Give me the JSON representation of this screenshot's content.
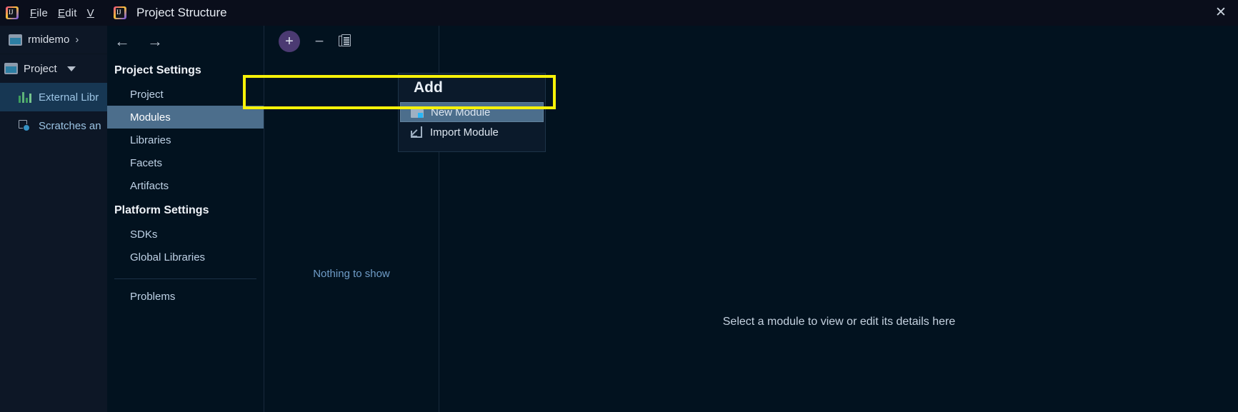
{
  "ide": {
    "logo_icon": "intellij-logo-icon",
    "menu": [
      {
        "label": "File",
        "mnemonic": "F",
        "rest": "ile"
      },
      {
        "label": "Edit",
        "mnemonic": "E",
        "rest": "dit"
      },
      {
        "label": "V",
        "mnemonic": "V",
        "rest": ""
      }
    ],
    "breadcrumb": {
      "project": "rmidemo",
      "chevron": "›",
      "icon": "module-icon"
    },
    "tool_window": {
      "title": "Project",
      "icon": "module-icon",
      "caret": "chevron-down-icon"
    },
    "tree": [
      {
        "label": "External Libr",
        "icon": "library-bars-icon",
        "selected": true
      },
      {
        "label": "Scratches an",
        "icon": "scratches-clock-icon",
        "selected": false
      }
    ]
  },
  "dialog": {
    "title": "Project Structure",
    "title_icon": "intellij-logo-icon",
    "close_label": "✕",
    "nav": {
      "back_arrow": "←",
      "forward_arrow": "→",
      "sections": [
        {
          "heading": "Project Settings",
          "items": [
            {
              "label": "Project",
              "selected": false
            },
            {
              "label": "Modules",
              "selected": true
            },
            {
              "label": "Libraries",
              "selected": false
            },
            {
              "label": "Facets",
              "selected": false
            },
            {
              "label": "Artifacts",
              "selected": false
            }
          ]
        },
        {
          "heading": "Platform Settings",
          "items": [
            {
              "label": "SDKs",
              "selected": false
            },
            {
              "label": "Global Libraries",
              "selected": false
            }
          ]
        }
      ],
      "footer_items": [
        {
          "label": "Problems",
          "selected": false
        }
      ]
    },
    "modules_panel": {
      "toolbar": {
        "add_label": "+",
        "remove_label": "−",
        "copy_label": "copy-icon"
      },
      "empty_text": "Nothing to show"
    },
    "detail_panel": {
      "empty_text": "Select a module to view or edit its details here"
    },
    "popup": {
      "heading": "Add",
      "items": [
        {
          "label": "New Module",
          "icon": "new-module-folder-icon",
          "highlighted": true
        },
        {
          "label": "Import Module",
          "icon": "import-module-arrow-icon",
          "highlighted": false
        }
      ]
    }
  },
  "annotation": {
    "highlight_color": "#f7f208",
    "target": "New Module"
  }
}
